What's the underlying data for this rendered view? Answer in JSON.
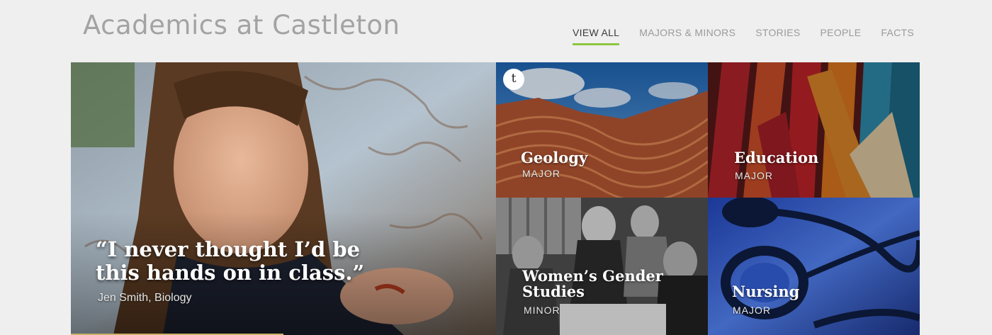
{
  "header": {
    "title": "Academics at Castleton",
    "nav": [
      {
        "label": "VIEW ALL",
        "active": true
      },
      {
        "label": "MAJORS & MINORS",
        "active": false
      },
      {
        "label": "STORIES",
        "active": false
      },
      {
        "label": "PEOPLE",
        "active": false
      },
      {
        "label": "FACTS",
        "active": false
      }
    ],
    "accent_color": "#8dc63f"
  },
  "hero": {
    "quote": "“I never thought I’d be this hands on in class.”",
    "attribution": "Jen Smith, Biology"
  },
  "tiles": [
    {
      "title": "Geology",
      "subtitle": "MAJOR",
      "badge": "t",
      "icon": "tumblr-icon"
    },
    {
      "title": "Education",
      "subtitle": "MAJOR"
    },
    {
      "title": "Women’s Gender Studies",
      "subtitle": "MINOR"
    },
    {
      "title": "Nursing",
      "subtitle": "MAJOR"
    }
  ]
}
